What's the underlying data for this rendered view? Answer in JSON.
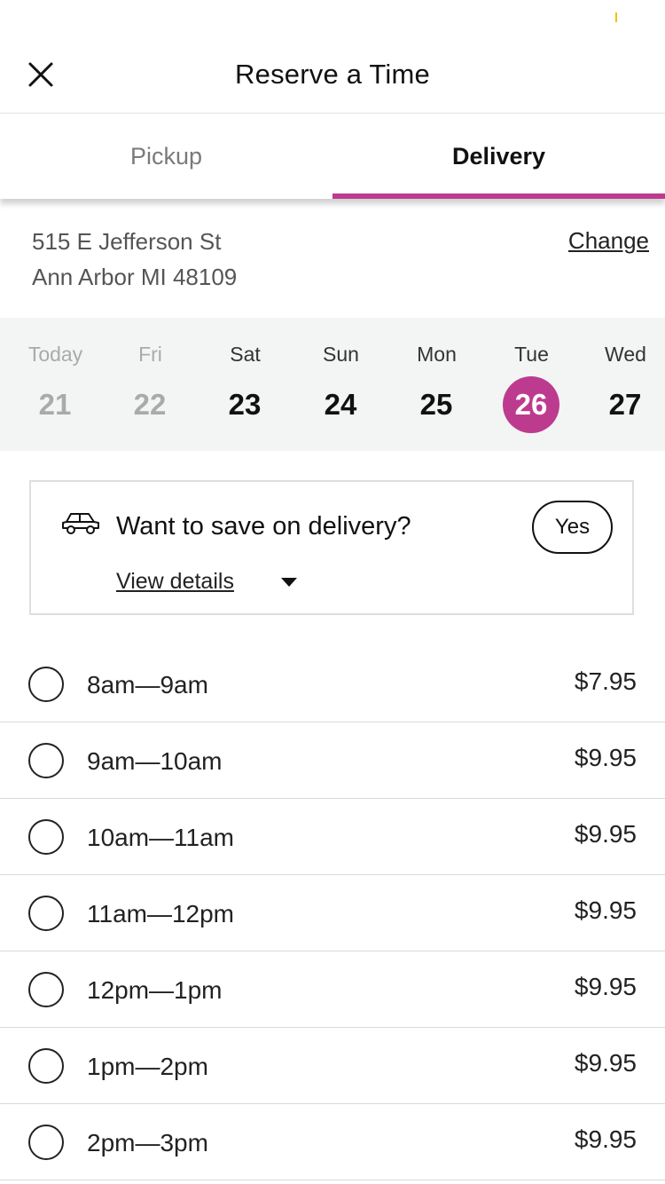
{
  "header": {
    "title": "Reserve a Time",
    "close_icon": "close-icon"
  },
  "tabs": [
    {
      "label": "Pickup",
      "active": false
    },
    {
      "label": "Delivery",
      "active": true
    }
  ],
  "address": {
    "line1": "515 E Jefferson St",
    "line2": "Ann Arbor MI 48109",
    "change_label": "Change"
  },
  "dates": [
    {
      "day": "Today",
      "date": "21",
      "state": "disabled"
    },
    {
      "day": "Fri",
      "date": "22",
      "state": "disabled"
    },
    {
      "day": "Sat",
      "date": "23",
      "state": "available"
    },
    {
      "day": "Sun",
      "date": "24",
      "state": "available"
    },
    {
      "day": "Mon",
      "date": "25",
      "state": "available"
    },
    {
      "day": "Tue",
      "date": "26",
      "state": "selected"
    },
    {
      "day": "Wed",
      "date": "27",
      "state": "available"
    }
  ],
  "promo": {
    "icon": "car-icon",
    "title": "Want to save on delivery?",
    "details_label": "View details",
    "yes_label": "Yes"
  },
  "slots": [
    {
      "time": "8am—9am",
      "price": "$7.95"
    },
    {
      "time": "9am—10am",
      "price": "$9.95"
    },
    {
      "time": "10am—11am",
      "price": "$9.95"
    },
    {
      "time": "11am—12pm",
      "price": "$9.95"
    },
    {
      "time": "12pm—1pm",
      "price": "$9.95"
    },
    {
      "time": "1pm—2pm",
      "price": "$9.95"
    },
    {
      "time": "2pm—3pm",
      "price": "$9.95"
    }
  ],
  "colors": {
    "accent": "#bd3b8f",
    "date_strip_bg": "#f3f5f4",
    "disabled_text": "#aaaaaa"
  }
}
